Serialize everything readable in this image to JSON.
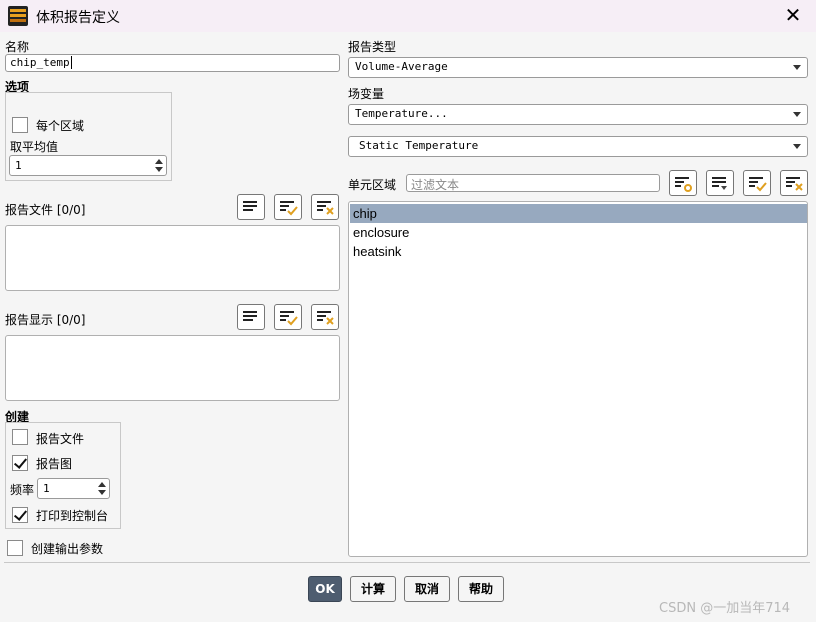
{
  "window": {
    "title": "体积报告定义",
    "close_icon": "close-icon"
  },
  "name": {
    "label": "名称",
    "value": "chip_temp"
  },
  "options": {
    "label": "选项",
    "per_zone_label": "每个区域",
    "per_zone_checked": false,
    "average_label": "取平均值",
    "average_value": "1"
  },
  "report_files": {
    "label": "报告文件 [0/0]"
  },
  "report_plots": {
    "label": "报告显示 [0/0]"
  },
  "create": {
    "label": "创建",
    "report_file_label": "报告文件",
    "report_file_checked": false,
    "report_plot_label": "报告图",
    "report_plot_checked": true,
    "frequency_label": "频率",
    "frequency_value": "1",
    "print_console_label": "打印到控制台",
    "print_console_checked": true,
    "output_param_label": "创建输出参数",
    "output_param_checked": false
  },
  "report_type": {
    "label": "报告类型",
    "value": "Volume-Average"
  },
  "field_variable": {
    "label": "场变量",
    "value": "Temperature...",
    "sub_value": "Static Temperature"
  },
  "cell_zones": {
    "label": "单元区域",
    "filter_placeholder": "过滤文本",
    "items": [
      {
        "label": "chip",
        "selected": true
      },
      {
        "label": "enclosure",
        "selected": false
      },
      {
        "label": "heatsink",
        "selected": false
      }
    ]
  },
  "buttons": {
    "ok": "OK",
    "compute": "计算",
    "cancel": "取消",
    "help": "帮助"
  },
  "watermark": "CSDN @一加当年714",
  "colors": {
    "selection": "#97a9bf",
    "ok_button": "#4e5d70",
    "titlebar": "#f6eef6",
    "icon_accent": "#e8a020"
  }
}
